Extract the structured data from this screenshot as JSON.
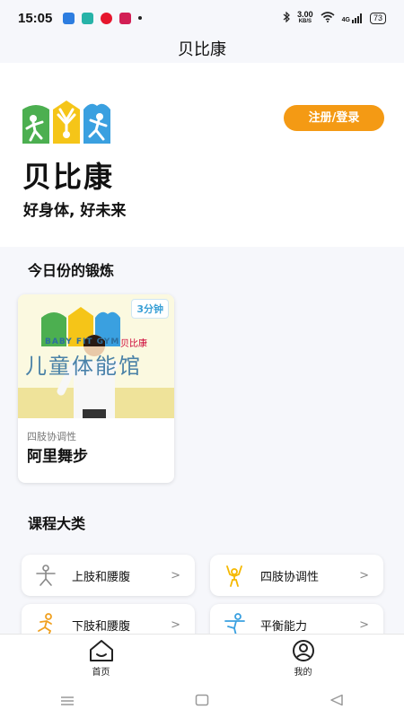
{
  "status_bar": {
    "time": "15:05",
    "net_speed_value": "3.00",
    "net_speed_unit": "KB/S",
    "signal": "4G",
    "battery": "73"
  },
  "app": {
    "title": "贝比康"
  },
  "hero": {
    "brand_name": "贝比康",
    "slogan": "好身体, 好未来",
    "login_button": "注册/登录"
  },
  "today": {
    "section_title": "今日份的锻炼",
    "card": {
      "duration": "3分钟",
      "category": "四肢协调性",
      "name": "阿里舞步",
      "thumb_sign": "儿童体能馆",
      "thumb_sign_en": "BABY FIT GYM",
      "thumb_brand": "贝比康"
    }
  },
  "courses": {
    "section_title": "课程大类",
    "items": [
      {
        "label": "上肢和腰腹",
        "icon": "upper-body-icon"
      },
      {
        "label": "四肢协调性",
        "icon": "coordination-icon"
      },
      {
        "label": "下肢和腰腹",
        "icon": "lower-body-icon"
      },
      {
        "label": "平衡能力",
        "icon": "balance-icon"
      }
    ],
    "chevron": ">"
  },
  "bottom_nav": {
    "home": "首页",
    "mine": "我的"
  },
  "colors": {
    "accent": "#f49a14",
    "logo_green": "#4caf50",
    "logo_yellow": "#f5c518",
    "logo_blue": "#3aa0e0"
  }
}
